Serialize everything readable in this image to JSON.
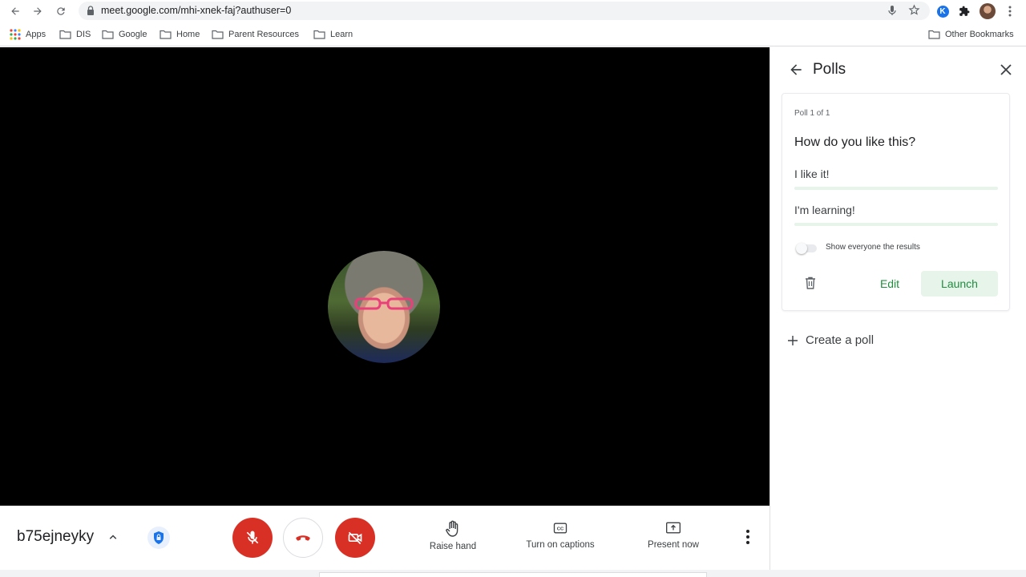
{
  "browser": {
    "url": "meet.google.com/mhi-xnek-faj?authuser=0",
    "extension_letter": "K",
    "bookmarks": [
      {
        "label": "Apps",
        "icon": "apps-grid-icon"
      },
      {
        "label": "DIS",
        "icon": "folder-icon"
      },
      {
        "label": "Google",
        "icon": "folder-icon"
      },
      {
        "label": "Home",
        "icon": "folder-icon"
      },
      {
        "label": "Parent Resources",
        "icon": "folder-icon"
      },
      {
        "label": "Learn",
        "icon": "folder-icon"
      }
    ],
    "other_bookmarks": "Other Bookmarks"
  },
  "meeting": {
    "code": "b75ejneyky",
    "mic_muted": true,
    "camera_off": true,
    "actions": {
      "raise_hand": "Raise hand",
      "captions": "Turn on captions",
      "present": "Present now"
    },
    "colors": {
      "danger": "#d93025",
      "accent": "#1a73e8"
    }
  },
  "polls_panel": {
    "title": "Polls",
    "poll": {
      "count_label": "Poll 1 of 1",
      "question": "How do you like this?",
      "options": [
        "I like it!",
        "I'm learning!"
      ],
      "show_results_label": "Show everyone the results",
      "show_results_on": false,
      "edit_label": "Edit",
      "launch_label": "Launch"
    },
    "create_label": "Create a poll",
    "colors": {
      "green": "#1e8e3e",
      "green_light": "#e6f4ea"
    }
  }
}
